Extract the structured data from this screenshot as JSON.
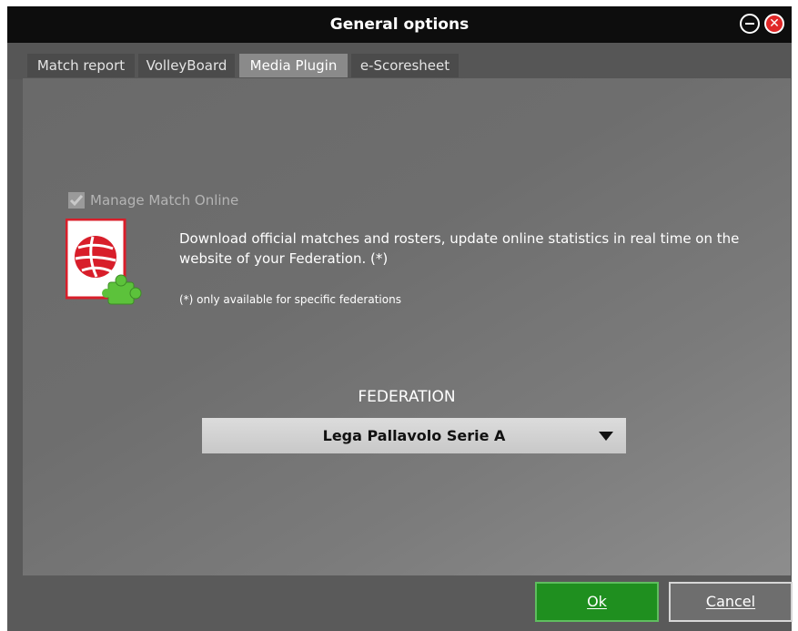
{
  "window": {
    "title": "General options"
  },
  "tabs": [
    {
      "label": "Match report",
      "active": false
    },
    {
      "label": "VolleyBoard",
      "active": false
    },
    {
      "label": "Media Plugin",
      "active": true
    },
    {
      "label": "e-Scoresheet",
      "active": false
    }
  ],
  "plugin": {
    "checkbox_label": "Manage Match Online",
    "checked": true,
    "description": "Download official matches and rosters, update online statistics in real time on the website of your Federation. (*)",
    "note": "(*) only available for specific federations",
    "icons": [
      "volleyball-icon",
      "puzzle-piece-icon"
    ]
  },
  "federation": {
    "label": "FEDERATION",
    "selected": "Lega Pallavolo Serie A"
  },
  "buttons": {
    "ok": "Ok",
    "cancel": "Cancel"
  },
  "colors": {
    "ok_button": "#1f8f1f",
    "close_button": "#e02727",
    "logo_red": "#d81e2a",
    "puzzle_green": "#5cc23b"
  }
}
